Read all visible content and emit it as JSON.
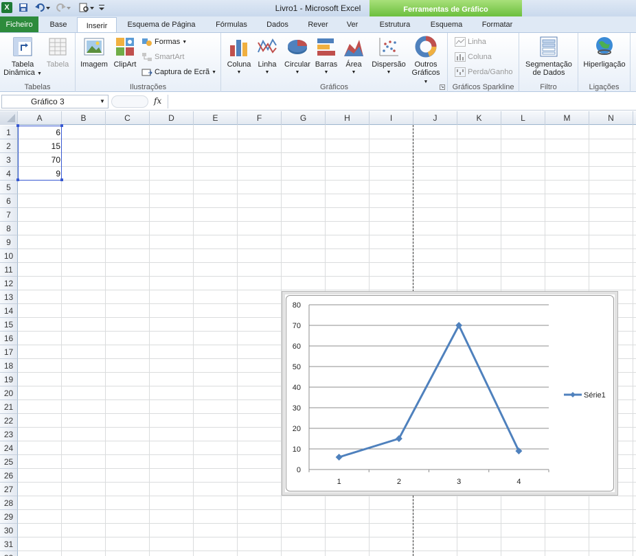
{
  "window": {
    "title": "Livro1",
    "separator": " - ",
    "app_name": "Microsoft Excel",
    "tools_header": "Ferramentas de Gráfico"
  },
  "tabs": [
    {
      "label": "Ficheiro"
    },
    {
      "label": "Base"
    },
    {
      "label": "Inserir"
    },
    {
      "label": "Esquema de Página"
    },
    {
      "label": "Fórmulas"
    },
    {
      "label": "Dados"
    },
    {
      "label": "Rever"
    },
    {
      "label": "Ver"
    },
    {
      "label": "Estrutura"
    },
    {
      "label": "Esquema"
    },
    {
      "label": "Formatar"
    }
  ],
  "active_tab": "Inserir",
  "ribbon": {
    "tabelas": {
      "label": "Tabelas",
      "pivot_line1": "Tabela",
      "pivot_line2": "Dinâmica",
      "table": "Tabela"
    },
    "ilustracoes": {
      "label": "Ilustrações",
      "image": "Imagem",
      "clipart": "ClipArt",
      "shapes": "Formas",
      "smartart": "SmartArt",
      "screenshot": "Captura de Ecrã"
    },
    "graficos": {
      "label": "Gráficos",
      "column": "Coluna",
      "line": "Linha",
      "pie": "Circular",
      "bar": "Barras",
      "area": "Área",
      "scatter": "Dispersão",
      "other_line1": "Outros",
      "other_line2": "Gráficos"
    },
    "sparkline": {
      "label": "Gráficos Sparkline",
      "line": "Linha",
      "column": "Coluna",
      "winloss": "Perda/Ganho"
    },
    "filtro": {
      "label": "Filtro",
      "slicer_line1": "Segmentação",
      "slicer_line2": "de Dados"
    },
    "ligacoes": {
      "label": "Ligações",
      "hyperlink": "Hiperligação"
    }
  },
  "formula_bar": {
    "name_box": "Gráfico 3",
    "fx": "fx",
    "value": ""
  },
  "columns": [
    "A",
    "B",
    "C",
    "D",
    "E",
    "F",
    "G",
    "H",
    "I",
    "J",
    "K",
    "L",
    "M",
    "N"
  ],
  "rows": [
    "1",
    "2",
    "3",
    "4",
    "5",
    "6",
    "7",
    "8",
    "9",
    "10",
    "11",
    "12",
    "13",
    "14",
    "15",
    "16",
    "17",
    "18",
    "19",
    "20",
    "21",
    "22",
    "23",
    "24",
    "25",
    "26",
    "27",
    "28",
    "29",
    "30",
    "31",
    "32"
  ],
  "cells": {
    "A1": "6",
    "A2": "15",
    "A3": "70",
    "A4": "9"
  },
  "colors": {
    "accent_green": "#2d8b3c",
    "series": "#4f81bd",
    "selection": "#3758d1"
  },
  "chart_data": {
    "type": "line",
    "x": [
      "1",
      "2",
      "3",
      "4"
    ],
    "series": [
      {
        "name": "Série1",
        "values": [
          6,
          15,
          70,
          9
        ],
        "marker": "diamond"
      }
    ],
    "ylim": [
      0,
      80
    ],
    "yticks": [
      "0",
      "10",
      "20",
      "30",
      "40",
      "50",
      "60",
      "70",
      "80"
    ],
    "grid": true,
    "legend_position": "right"
  }
}
